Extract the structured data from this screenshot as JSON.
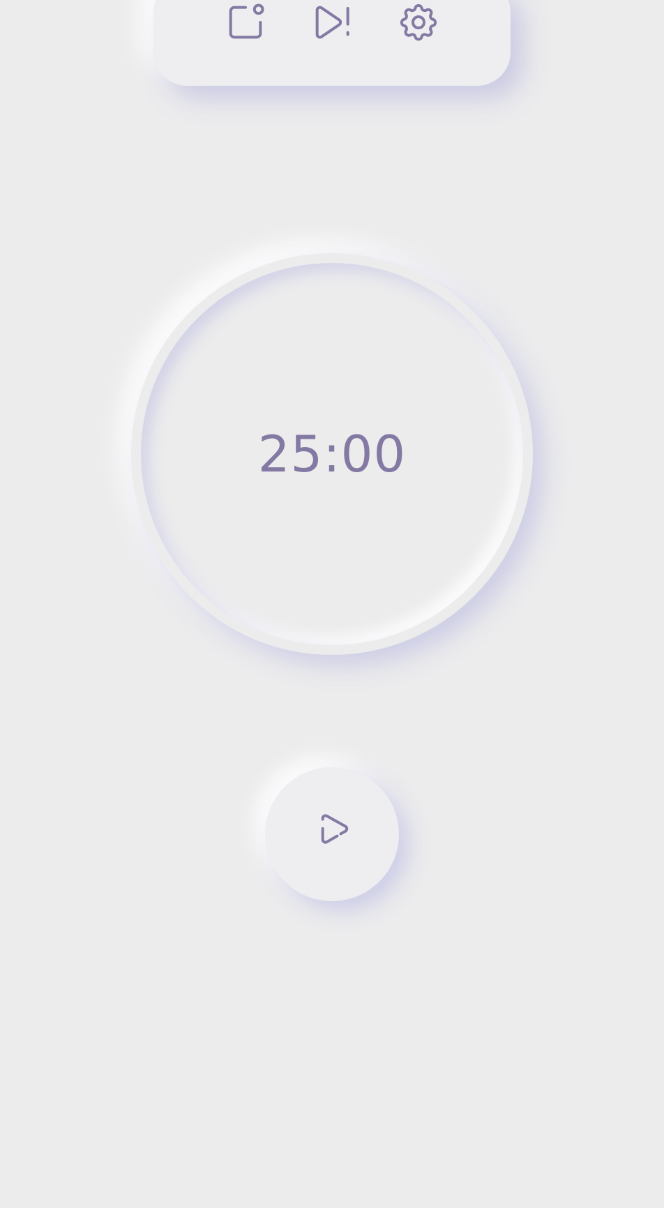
{
  "toolbar": {
    "buttons": [
      {
        "name": "notification-button",
        "icon": "app-notification-icon"
      },
      {
        "name": "autoplay-alert-button",
        "icon": "play-alert-icon"
      },
      {
        "name": "settings-button",
        "icon": "gear-icon"
      }
    ]
  },
  "timer": {
    "display": "25:00"
  },
  "controls": {
    "play_icon": "play-icon"
  },
  "colors": {
    "background": "#ececed",
    "accent": "#8479a3"
  }
}
